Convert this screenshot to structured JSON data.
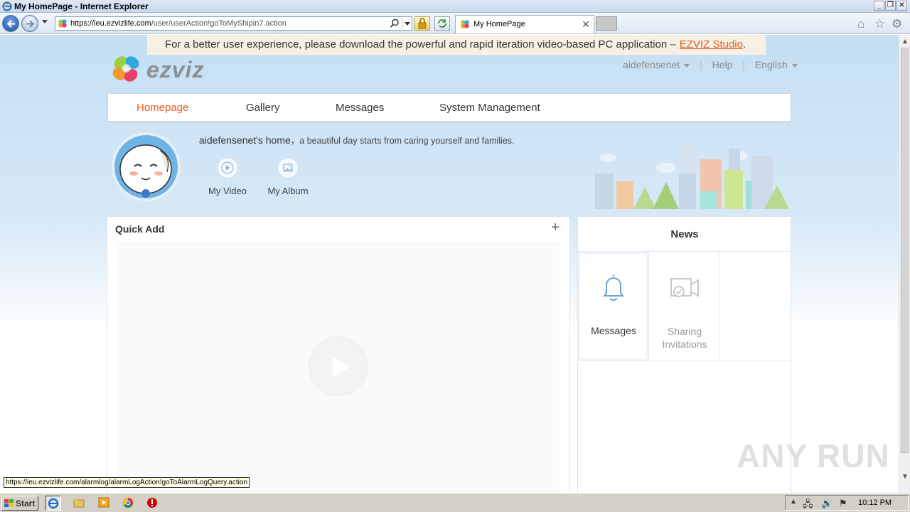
{
  "window": {
    "title": "My HomePage - Internet Explorer",
    "controls": [
      "_",
      "❐",
      "✕"
    ]
  },
  "browser": {
    "url_host": "https://ieu.ezvizlife.com",
    "url_path": "/user/userAction!goToMyShipin7.action",
    "tab_title": "My HomePage",
    "tab_close": "✕"
  },
  "banner": {
    "text": "For a better user experience, please download the powerful and rapid iteration video-based PC application –",
    "link": "EZVIZ Studio",
    "period": "."
  },
  "brand": {
    "name": "ezviz",
    "accent": "#e85a1e"
  },
  "topright": {
    "user": "aidefensenet",
    "help": "Help",
    "language": "English",
    "separator": "|"
  },
  "nav": {
    "items": [
      {
        "label": "Homepage",
        "active": true
      },
      {
        "label": "Gallery",
        "active": false
      },
      {
        "label": "Messages",
        "active": false
      },
      {
        "label": "System Management",
        "active": false
      }
    ]
  },
  "profile": {
    "home_title": "aidefensenet's home",
    "tagline": "，a beautiful day starts from caring yourself and families.",
    "shortcuts": [
      {
        "label": "My Video",
        "icon": "play-icon"
      },
      {
        "label": "My Album",
        "icon": "image-icon"
      }
    ]
  },
  "quick_add": {
    "title": "Quick Add",
    "add_symbol": "+"
  },
  "news": {
    "title": "News",
    "items": [
      {
        "label": "Messages",
        "icon": "bell-icon"
      },
      {
        "label": "Sharing\nInvitations",
        "icon": "camera-check-icon"
      }
    ]
  },
  "watermark": "ANY RUN",
  "status_url": "https://ieu.ezvizlife.com/alarmlog/alarmLogAction!goToAlarmLogQuery.action",
  "taskbar": {
    "start": "Start",
    "clock": "10:12 PM"
  }
}
